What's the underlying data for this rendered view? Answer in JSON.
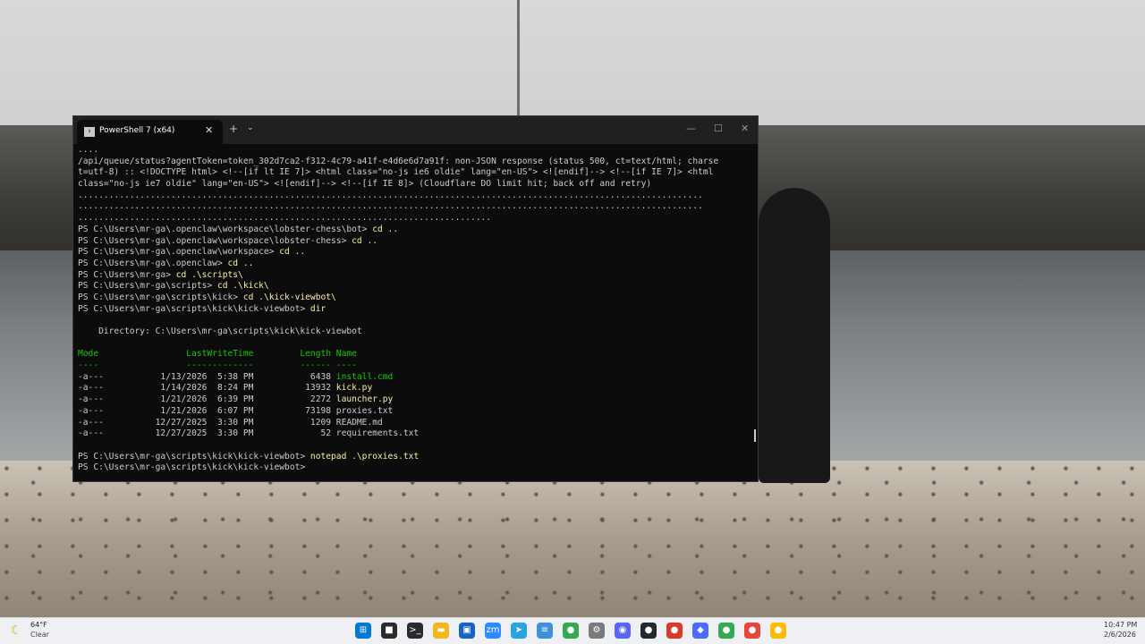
{
  "window": {
    "tab_title": "PowerShell 7 (x64)",
    "tab_close_glyph": "✕",
    "new_tab_glyph": "+",
    "dropdown_glyph": "⌄",
    "minimize_glyph": "—",
    "maximize_glyph": "☐",
    "close_glyph": "✕"
  },
  "console": {
    "lines": [
      {
        "text": "....",
        "style": "out"
      },
      {
        "text": "/api/queue/status?agentToken=token_302d7ca2-f312-4c79-a41f-e4d6e6d7a91f: non-JSON response (status 500, ct=text/html; charse",
        "style": "out"
      },
      {
        "text": "t=utf-8) :: <!DOCTYPE html> <!--[if lt IE 7]> <html class=\"no-js ie6 oldie\" lang=\"en-US\"> <![endif]--> <!--[if IE 7]> <html",
        "style": "out"
      },
      {
        "text": "class=\"no-js ie7 oldie\" lang=\"en-US\"> <![endif]--> <!--[if IE 8]> (Cloudflare DO limit hit; back off and retry)",
        "style": "out"
      },
      {
        "text": ".........................................................................................................................",
        "style": "out"
      },
      {
        "text": ".........................................................................................................................",
        "style": "out"
      },
      {
        "text": "................................................................................",
        "style": "out"
      },
      {
        "prompt": "PS C:\\Users\\mr-ga\\.openclaw\\workspace\\lobster-chess\\bot> ",
        "command": "cd ..",
        "style": "prompt"
      },
      {
        "prompt": "PS C:\\Users\\mr-ga\\.openclaw\\workspace\\lobster-chess> ",
        "command": "cd ..",
        "style": "prompt"
      },
      {
        "prompt": "PS C:\\Users\\mr-ga\\.openclaw\\workspace> ",
        "command": "cd ..",
        "style": "prompt"
      },
      {
        "prompt": "PS C:\\Users\\mr-ga\\.openclaw> ",
        "command": "cd ..",
        "style": "prompt"
      },
      {
        "prompt": "PS C:\\Users\\mr-ga> ",
        "command": "cd .\\scripts\\",
        "style": "prompt"
      },
      {
        "prompt": "PS C:\\Users\\mr-ga\\scripts> ",
        "command": "cd .\\kick\\",
        "style": "prompt"
      },
      {
        "prompt": "PS C:\\Users\\mr-ga\\scripts\\kick> ",
        "command": "cd .\\kick-viewbot\\",
        "style": "prompt"
      },
      {
        "prompt": "PS C:\\Users\\mr-ga\\scripts\\kick\\kick-viewbot> ",
        "command": "dir",
        "style": "prompt"
      },
      {
        "text": "",
        "style": "out"
      },
      {
        "text": "    Directory: C:\\Users\\mr-ga\\scripts\\kick\\kick-viewbot",
        "style": "out"
      },
      {
        "text": "",
        "style": "out"
      },
      {
        "text": "Mode                 LastWriteTime         Length Name",
        "style": "hdr"
      },
      {
        "text": "----                 -------------         ------ ----",
        "style": "hdr"
      },
      {
        "cols": "-a---           1/13/2026  5:38 PM           6438 ",
        "name": "install.cmd",
        "name_style": "green"
      },
      {
        "cols": "-a---           1/14/2026  8:24 PM          13932 ",
        "name": "kick.py",
        "name_style": "cmd"
      },
      {
        "cols": "-a---           1/21/2026  6:39 PM           2272 ",
        "name": "launcher.py",
        "name_style": "cmd"
      },
      {
        "cols": "-a---           1/21/2026  6:07 PM          73198 ",
        "name": "proxies.txt",
        "name_style": "out"
      },
      {
        "cols": "-a---          12/27/2025  3:30 PM           1209 ",
        "name": "README.md",
        "name_style": "out"
      },
      {
        "cols": "-a---          12/27/2025  3:30 PM             52 ",
        "name": "requirements.txt",
        "name_style": "out"
      },
      {
        "text": "",
        "style": "out"
      },
      {
        "prompt": "PS C:\\Users\\mr-ga\\scripts\\kick\\kick-viewbot> ",
        "command": "notepad .\\proxies.txt",
        "style": "prompt"
      },
      {
        "prompt": "PS C:\\Users\\mr-ga\\scripts\\kick\\kick-viewbot> ",
        "command": "",
        "style": "prompt"
      }
    ]
  },
  "taskbar": {
    "weather_temp": "64°F",
    "weather_condition": "Clear",
    "time": "10:47 PM",
    "date": "2/6/2026",
    "apps": [
      {
        "name": "start-icon",
        "glyph": "⊞",
        "color": "#0078d4"
      },
      {
        "name": "task-view-icon",
        "glyph": "■",
        "color": "#2b2b2b"
      },
      {
        "name": "terminal-app-icon",
        "glyph": ">_",
        "color": "#2b2b2b"
      },
      {
        "name": "file-explorer-icon",
        "glyph": "▬",
        "color": "#f3b61f"
      },
      {
        "name": "store-icon",
        "glyph": "▣",
        "color": "#1565c0"
      },
      {
        "name": "zoom-icon",
        "glyph": "zm",
        "color": "#2d8cff"
      },
      {
        "name": "telegram-icon",
        "glyph": "➤",
        "color": "#2aa3df"
      },
      {
        "name": "notepad-icon",
        "glyph": "≡",
        "color": "#3f8fd9"
      },
      {
        "name": "chrome-icon",
        "glyph": "●",
        "color": "#34a853"
      },
      {
        "name": "settings-icon",
        "glyph": "⚙",
        "color": "#7a7a7a"
      },
      {
        "name": "discord-icon",
        "glyph": "◉",
        "color": "#5865f2"
      },
      {
        "name": "github-icon",
        "glyph": "●",
        "color": "#24292e"
      },
      {
        "name": "reddit-icon",
        "glyph": "●",
        "color": "#d93a2b"
      },
      {
        "name": "game-icon",
        "glyph": "◆",
        "color": "#4d6bfe"
      },
      {
        "name": "chrome-icon-2",
        "glyph": "●",
        "color": "#34a853"
      },
      {
        "name": "chrome-icon-3",
        "glyph": "●",
        "color": "#e8453c"
      },
      {
        "name": "chrome-icon-4",
        "glyph": "●",
        "color": "#fbbc05"
      }
    ]
  }
}
